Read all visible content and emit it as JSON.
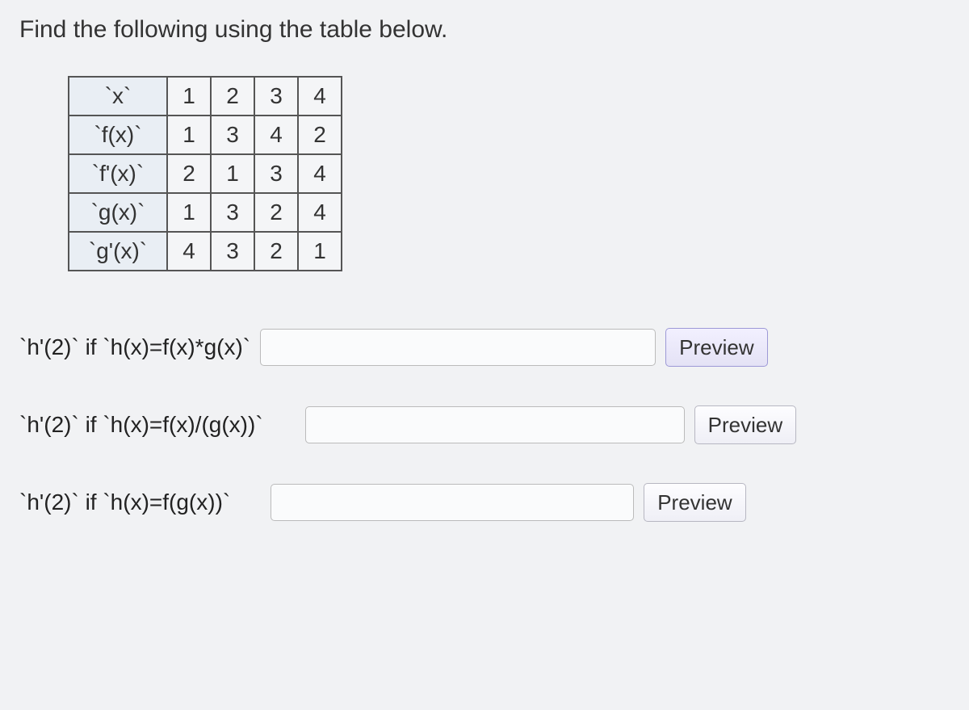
{
  "prompt": "Find the following using the table below.",
  "table": {
    "row_labels": [
      "`x`",
      "`f(x)`",
      "`f'(x)`",
      "`g(x)`",
      "`g'(x)`"
    ],
    "rows": [
      [
        "1",
        "2",
        "3",
        "4"
      ],
      [
        "1",
        "3",
        "4",
        "2"
      ],
      [
        "2",
        "1",
        "3",
        "4"
      ],
      [
        "1",
        "3",
        "2",
        "4"
      ],
      [
        "4",
        "3",
        "2",
        "1"
      ]
    ]
  },
  "questions": [
    {
      "label": "`h'(2)` if `h(x)=f(x)*g(x)`",
      "value": "",
      "button": "Preview"
    },
    {
      "label": "`h'(2)` if `h(x)=f(x)/(g(x))`",
      "value": "",
      "button": "Preview"
    },
    {
      "label": "`h'(2)` if `h(x)=f(g(x))`",
      "value": "",
      "button": "Preview"
    }
  ],
  "chart_data": {
    "type": "table",
    "title": "Function value table",
    "columns": [
      "x",
      "f(x)",
      "f'(x)",
      "g(x)",
      "g'(x)"
    ],
    "x": [
      1,
      2,
      3,
      4
    ],
    "series": [
      {
        "name": "f(x)",
        "values": [
          1,
          3,
          4,
          2
        ]
      },
      {
        "name": "f'(x)",
        "values": [
          2,
          1,
          3,
          4
        ]
      },
      {
        "name": "g(x)",
        "values": [
          1,
          3,
          2,
          4
        ]
      },
      {
        "name": "g'(x)",
        "values": [
          4,
          3,
          2,
          1
        ]
      }
    ]
  }
}
